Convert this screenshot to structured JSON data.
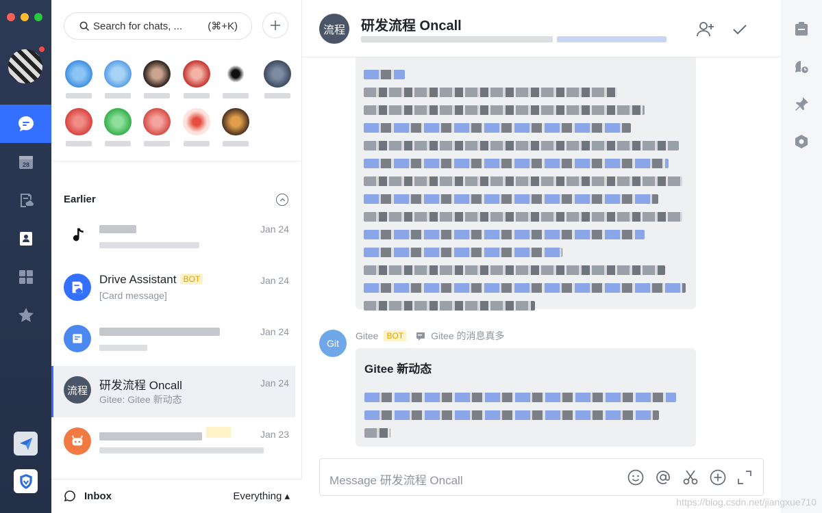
{
  "search": {
    "placeholder": "Search for chats, ...",
    "shortcut": "(⌘+K)"
  },
  "list": {
    "section_title": "Earlier",
    "rows": [
      {
        "name": "",
        "sub": "",
        "date": "Jan 24",
        "avatar_color": "#ffffff"
      },
      {
        "name": "Drive Assistant",
        "badge": "BOT",
        "sub": "[Card message]",
        "date": "Jan 24",
        "avatar_color": "#3370ff"
      },
      {
        "name": "",
        "sub": "",
        "date": "Jan 24",
        "avatar_color": "#4a88f0"
      },
      {
        "name": "研发流程 Oncall",
        "sub": "Gitee: Gitee 新动态",
        "date": "Jan 24",
        "avatar_text": "流程",
        "avatar_color": "#4b5568"
      },
      {
        "name": "",
        "sub": "",
        "date": "Jan 23",
        "avatar_color": "#f27a42"
      }
    ],
    "footer": {
      "inbox": "Inbox",
      "filter": "Everything ▴"
    }
  },
  "chat": {
    "title": "研发流程 Oncall",
    "avatar_text": "流程",
    "sender": {
      "avatar_text": "Git",
      "name": "Gitee",
      "badge": "BOT",
      "thread": "Gitee 的消息真多"
    },
    "card_title": "Gitee 新动态",
    "composer_placeholder": "Message 研发流程 Oncall"
  },
  "watermark": "https://blog.csdn.net/jiangxue710",
  "colors": {
    "accent": "#3370ff",
    "rail": "#2d3a55",
    "bot_badge": "#fdf2c8"
  }
}
